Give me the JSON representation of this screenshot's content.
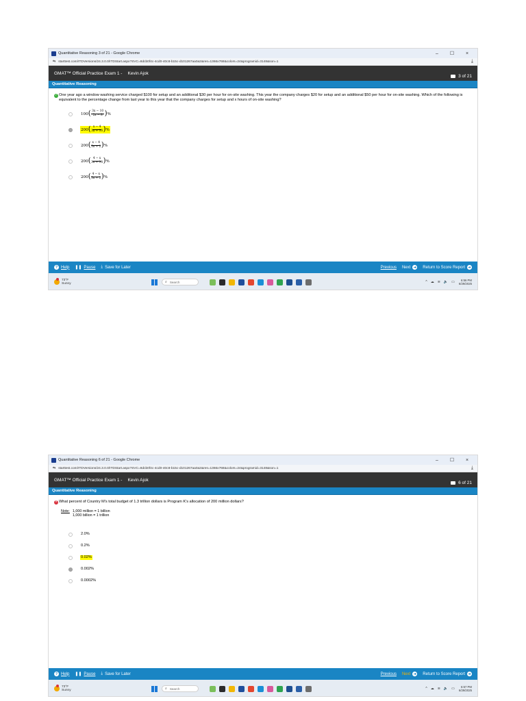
{
  "screens": [
    {
      "window_title": "Quantitative Reasoning 3 of 21 - Google Chrome",
      "url": "starttest.com/ITDVersions/24.3.0.0/ITDStart.aspx?SVC=8dcb0f4c-4cd0-40c8-b15c-d101267aa0a2&res=1366x768&colors=24&programid=3148&son=1",
      "exam_title": "GMAT™ Official Practice Exam 1 -",
      "candidate": "Kevin Ajok",
      "question_count": "3 of 21",
      "section": "Quantitative Reasoning",
      "status": "correct",
      "question": "One year ago a window washing service charged $100 for setup and an additional $30 per hour for on-site washing. This year the company charges $20 for setup and an additional $50 per hour for on-site washing. Which of the following is equivalent to the percentage change from last year to this year that the company charges for setup and x hours of on-site washing?",
      "choices": [
        {
          "coef": "100",
          "num": "3x − 10",
          "den": "2x − 8",
          "suffix": "%",
          "selected": false,
          "highlighted": false
        },
        {
          "coef": "200",
          "num": "x − 4",
          "den": "3x + 10",
          "suffix": "%",
          "selected": true,
          "highlighted": true
        },
        {
          "coef": "200",
          "num": "x − 4",
          "den": "5x + 2",
          "suffix": "%",
          "selected": false,
          "highlighted": false
        },
        {
          "coef": "200",
          "num": "4 − x",
          "den": "3x + 10",
          "suffix": "%",
          "selected": false,
          "highlighted": false
        },
        {
          "coef": "200",
          "num": "4 − x",
          "den": "5x + 2",
          "suffix": "%",
          "selected": false,
          "highlighted": false
        }
      ],
      "nav": {
        "help": "Help",
        "pause": "Pause",
        "save": "Save for Later",
        "previous": "Previous",
        "next": "Next",
        "return": "Return to Score Report"
      },
      "taskbar": {
        "temp": "73°F",
        "weather": "Sunny",
        "search": "Search",
        "time": "6:56 PM",
        "date": "6/29/2025"
      }
    },
    {
      "window_title": "Quantitative Reasoning 6 of 21 - Google Chrome",
      "url": "starttest.com/ITDVersions/24.3.0.0/ITDStart.aspx?SVC=8dcb0f4c-4cd0-40c8-b15c-d101267aa0a2&res=1366x768&colors=24&programid=3148&son=1",
      "exam_title": "GMAT™ Official Practice Exam 1 -",
      "candidate": "Kevin Ajok",
      "question_count": "6 of 21",
      "section": "Quantitative Reasoning",
      "status": "incorrect",
      "question": "What percent of Country M's total budget of 1.3 trillion dollars is Program K's allocation of 200 million dollars?",
      "note_label": "Note:",
      "note_line1": "1,000 million = 1 billion",
      "note_line2": "1,000 billion = 1 trillion",
      "choices": [
        {
          "text": "2.0%",
          "selected": false,
          "highlighted": false
        },
        {
          "text": "0.2%",
          "selected": false,
          "highlighted": false
        },
        {
          "text": "0.02%",
          "selected": false,
          "highlighted": true
        },
        {
          "text": "0.002%",
          "selected": true,
          "highlighted": false
        },
        {
          "text": "0.0002%",
          "selected": false,
          "highlighted": false
        }
      ],
      "nav": {
        "help": "Help",
        "pause": "Pause",
        "save": "Save for Later",
        "previous": "Previous",
        "next": "Next",
        "return": "Return to Score Report"
      },
      "taskbar": {
        "temp": "73°F",
        "weather": "Sunny",
        "search": "Search",
        "time": "6:57 PM",
        "date": "6/29/2025"
      }
    }
  ],
  "colors": {
    "section_blue": "#1a85c4",
    "header_dark": "#333333",
    "highlight": "#fffb00",
    "correct": "#3cae3c",
    "incorrect": "#d9333f"
  }
}
